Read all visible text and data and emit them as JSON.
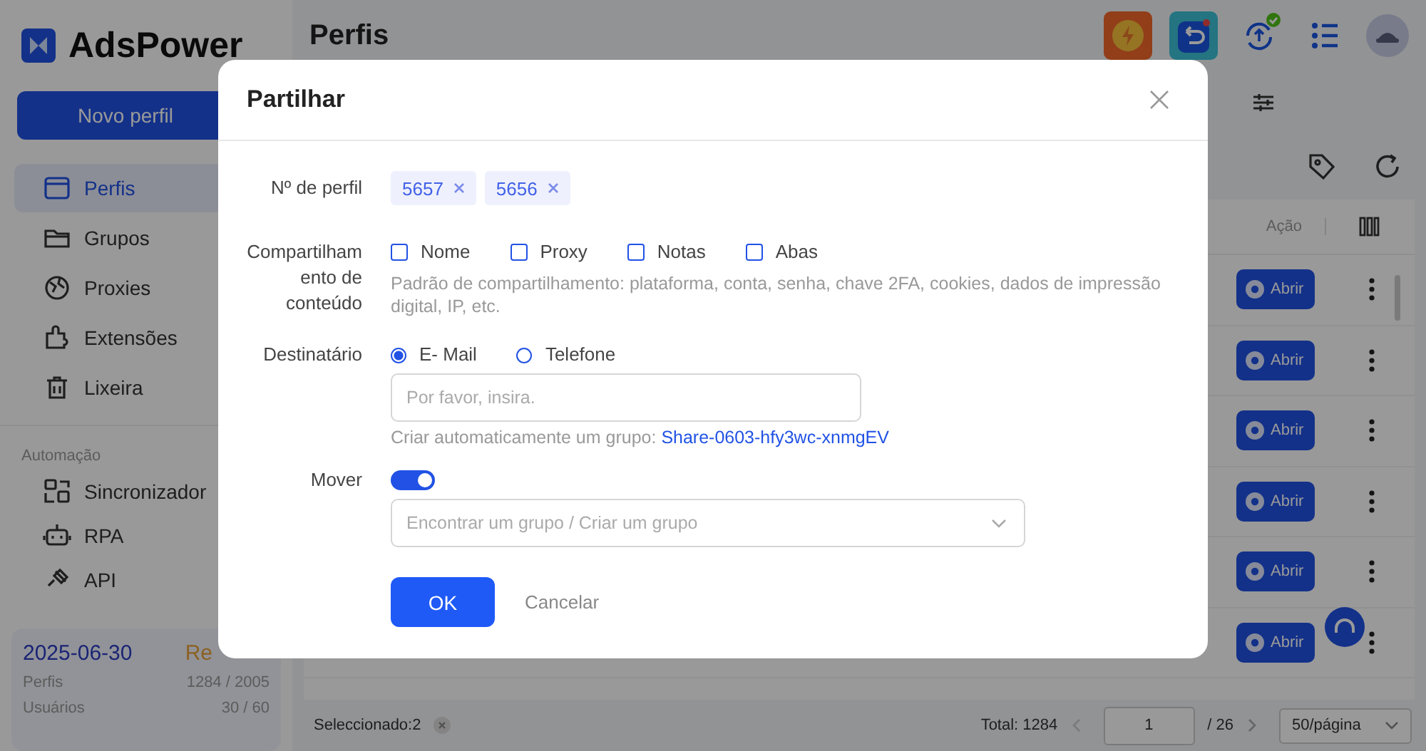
{
  "app": {
    "brand": "AdsPower",
    "page_title": "Perfis",
    "new_profile_button": "Novo perfil",
    "nav_items": [
      {
        "label": "Perfis",
        "selected": true
      },
      {
        "label": "Grupos",
        "selected": false
      },
      {
        "label": "Proxies",
        "selected": false
      },
      {
        "label": "Extensões",
        "selected": false
      },
      {
        "label": "Lixeira",
        "selected": false
      }
    ],
    "automation_title": "Automação",
    "automation_items": [
      {
        "label": "Sincronizador"
      },
      {
        "label": "RPA"
      },
      {
        "label": "API"
      }
    ],
    "plan": {
      "expiry": "2025-06-30",
      "renew": "Re",
      "stats": [
        {
          "label": "Perfis",
          "value": "1284 / 2005"
        },
        {
          "label": "Usuários",
          "value": "30 / 60"
        }
      ]
    },
    "table": {
      "action_header": "Ação",
      "rows": [
        {
          "action": "Abrir"
        },
        {
          "action": "Abrir"
        },
        {
          "action": "Abrir"
        },
        {
          "action": "Abrir"
        },
        {
          "action": "Abrir"
        },
        {
          "action": "Abrir"
        }
      ]
    },
    "footer": {
      "selected": "Seleccionado:2",
      "total": "Total: 1284",
      "page": "1",
      "page_count": "/ 26",
      "page_size": "50/página"
    }
  },
  "dialog": {
    "title": "Partilhar",
    "profile_label": "Nº de perfil",
    "profile_tags": [
      "5657",
      "5656"
    ],
    "content_label": "Compartilhamento de conteúdo",
    "content_options": [
      {
        "label": "Nome",
        "checked": false
      },
      {
        "label": "Proxy",
        "checked": false
      },
      {
        "label": "Notas",
        "checked": false
      },
      {
        "label": "Abas",
        "checked": false
      }
    ],
    "content_hint": "Padrão de compartilhamento: plataforma, conta, senha, chave 2FA, cookies, dados de impressão digital, IP, etc.",
    "recipient_label": "Destinatário",
    "recipient_options": [
      {
        "label": "E- Mail",
        "selected": true
      },
      {
        "label": "Telefone",
        "selected": false
      }
    ],
    "recipient_input": {
      "placeholder": "Por favor, insira."
    },
    "auto_group_note": "Criar automaticamente um grupo:",
    "auto_group_link": "Share-0603-hfy3wc-xnmgEV",
    "move_label": "Mover",
    "move": {
      "on": true
    },
    "group_select": {
      "placeholder": "Encontrar um grupo / Criar um grupo"
    },
    "ok_button": "OK",
    "cancel_button": "Cancelar"
  }
}
